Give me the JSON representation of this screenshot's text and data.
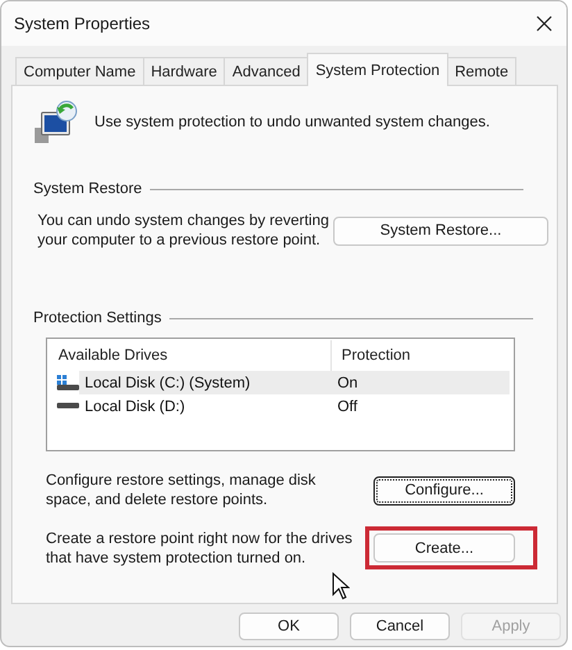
{
  "window": {
    "title": "System Properties"
  },
  "tabs": [
    {
      "label": "Computer Name",
      "selected": false
    },
    {
      "label": "Hardware",
      "selected": false
    },
    {
      "label": "Advanced",
      "selected": false
    },
    {
      "label": "System Protection",
      "selected": true
    },
    {
      "label": "Remote",
      "selected": false
    }
  ],
  "intro": "Use system protection to undo unwanted system changes.",
  "system_restore": {
    "heading": "System Restore",
    "description": "You can undo system changes by reverting your computer to a previous restore point.",
    "button": {
      "label": "System Restore...",
      "focused": false,
      "highlighted": false
    }
  },
  "protection_settings": {
    "heading": "Protection Settings",
    "columns": [
      "Available Drives",
      "Protection"
    ],
    "drives": [
      {
        "name": "Local Disk (C:) (System)",
        "protection": "On",
        "kind": "system",
        "selected": true
      },
      {
        "name": "Local Disk (D:)",
        "protection": "Off",
        "kind": "plain",
        "selected": false
      }
    ],
    "configure": {
      "description": "Configure restore settings, manage disk space, and delete restore points.",
      "button": {
        "label": "Configure...",
        "focused": true,
        "highlighted": false
      }
    },
    "create": {
      "description": "Create a restore point right now for the drives that have system protection turned on.",
      "button": {
        "label": "Create...",
        "focused": false,
        "highlighted": true
      }
    }
  },
  "buttons": [
    {
      "label": "OK",
      "disabled": false
    },
    {
      "label": "Cancel",
      "disabled": false
    },
    {
      "label": "Apply",
      "disabled": true
    }
  ]
}
